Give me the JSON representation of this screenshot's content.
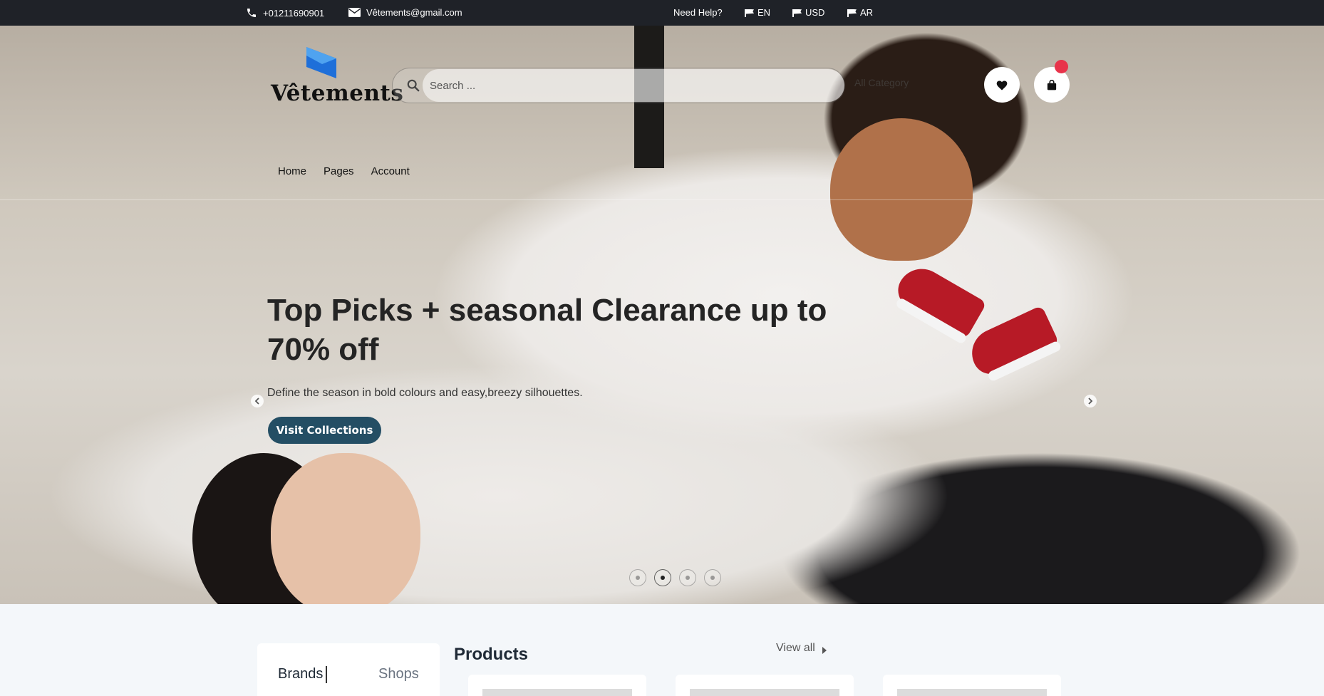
{
  "topbar": {
    "phone": "+01211690901",
    "email": "Vêtements@gmail.com",
    "help": "Need Help?",
    "lang": "EN",
    "currency": "USD",
    "lang_alt": "AR"
  },
  "header": {
    "logo_text": "Vêtements",
    "search_placeholder": "Search ...",
    "category": "All Category"
  },
  "menu": {
    "items": [
      "Home",
      "Pages",
      "Account"
    ]
  },
  "hero": {
    "headline": "Top Picks + seasonal Clearance up to 70% off",
    "subline": "Define the season in bold colours and easy,breezy silhouettes.",
    "cta": "Visit Collections",
    "slides_total": 4,
    "active_slide": 2
  },
  "tabs": [
    "Brands",
    "Shops"
  ],
  "products": {
    "title": "Products",
    "view_all": "View all"
  },
  "colors": {
    "topbar_bg": "#1f2228",
    "cta_bg": "#244e64",
    "cart_badge": "#e8334a"
  },
  "icons": [
    "phone-icon",
    "mail-icon",
    "flag-icon",
    "search-icon",
    "heart-icon",
    "bag-icon",
    "chevron-left-icon",
    "chevron-right-icon",
    "caret-right-icon"
  ]
}
